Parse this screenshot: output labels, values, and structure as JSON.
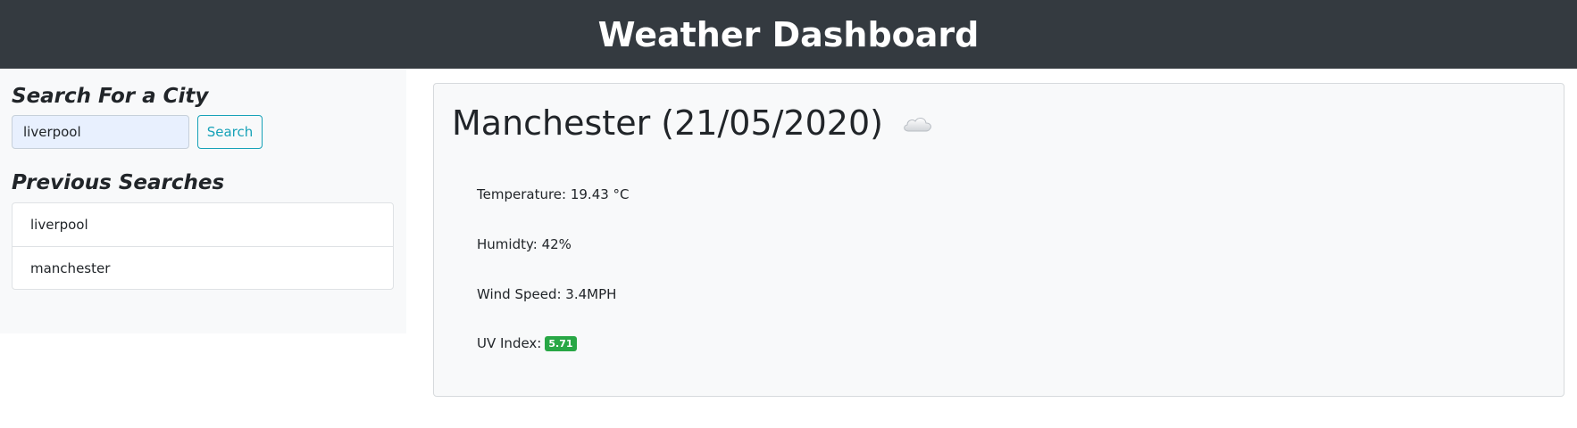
{
  "header": {
    "title": "Weather Dashboard"
  },
  "sidebar": {
    "search_heading": "Search For a City",
    "search_input": {
      "value": "liverpool",
      "placeholder": ""
    },
    "search_button_label": "Search",
    "previous_heading": "Previous Searches",
    "history": [
      {
        "label": "liverpool"
      },
      {
        "label": "manchester"
      }
    ]
  },
  "current": {
    "heading": "Manchester (21/05/2020)",
    "icon": "cloud-icon",
    "temperature_label": "Temperature: 19.43 °C",
    "humidity_label": "Humidty: 42%",
    "wind_label": "Wind Speed: 3.4MPH",
    "uv_label": "UV Index:",
    "uv_value": "5.71",
    "uv_color": "#28a745"
  },
  "colors": {
    "header_bg": "#343a40",
    "accent": "#17a2b8",
    "panel_bg": "#f8f9fa"
  }
}
